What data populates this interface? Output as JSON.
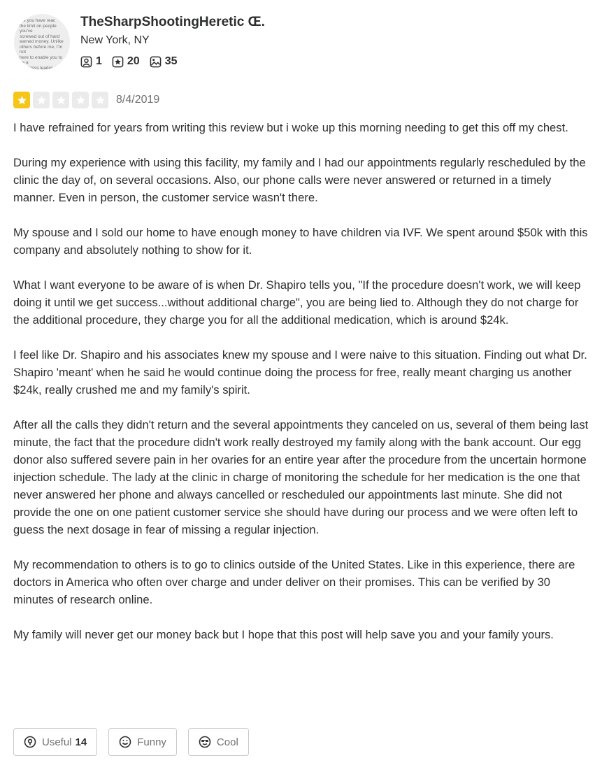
{
  "user": {
    "name": "TheSharpShootingHeretic Œ.",
    "location": "New York, NY",
    "avatar_text": "...s you have reac\nthe limit on people you've\nscrewed out of hard\nearned money. Unlike\nothers before me, I'm not\nhere to enable you to be a\nworthless leader. I'm\ngoing to hold you to the\nexpectation your mom\nshould have...",
    "stats": {
      "friends": "1",
      "reviews": "20",
      "photos": "35"
    }
  },
  "review": {
    "rating": 1,
    "max_rating": 5,
    "date": "8/4/2019",
    "paragraphs": [
      "I have refrained for years from writing this review but i woke up this morning needing to get this off my chest.",
      "During my experience with using this facility, my family and I had our appointments regularly rescheduled by the clinic the day of, on several occasions. Also, our phone calls were never answered or returned in a timely manner. Even in person, the customer service wasn't there.",
      "My spouse and I sold our home to have enough money to have children via IVF. We spent around $50k with this company and absolutely nothing to show for it.",
      "What I want everyone to be aware of is when Dr. Shapiro tells you, \"If the procedure doesn't work, we will keep doing it until we get success...without additional charge\", you are being lied to. Although they do not charge for the additional procedure, they charge you for all the additional medication, which is around $24k.",
      "I feel like Dr. Shapiro and his associates knew my spouse and I were naive to this situation. Finding out what Dr. Shapiro 'meant' when he said he would continue doing the process for free, really meant charging us another $24k, really crushed me and my family's spirit.",
      "After all the calls they didn't return and the several appointments they canceled on us, several of them being last minute, the fact that the procedure didn't work really destroyed my family along with the bank account. Our egg donor also suffered severe pain in her ovaries for an entire year after the procedure from the uncertain hormone injection schedule. The lady at the clinic in charge of monitoring the schedule for her medication is the one that never answered her phone and always cancelled or rescheduled our appointments last minute. She did not provide the one on one patient customer service she should have during our process and we were often left to guess the next dosage in fear of missing a regular injection.",
      "My recommendation to others is to go to clinics outside of the United States. Like in this experience, there are doctors in America who often over charge and under deliver on their promises. This can be verified by 30 minutes of research online.",
      "My family will never get our money back but I hope that this post will help save you and your family yours."
    ]
  },
  "reactions": {
    "useful_label": "Useful",
    "useful_count": "14",
    "funny_label": "Funny",
    "cool_label": "Cool"
  },
  "colors": {
    "star_on": "#f5c518",
    "star_off": "#ebebeb",
    "text": "#2d2e2f",
    "muted": "#6e7072",
    "border": "#c8c9ca"
  },
  "icons": {
    "friends": "friends-icon",
    "reviews": "reviews-icon",
    "photos": "photos-icon",
    "star": "star-icon",
    "useful": "lightbulb-icon",
    "funny": "smiley-icon",
    "cool": "sunglasses-icon"
  }
}
